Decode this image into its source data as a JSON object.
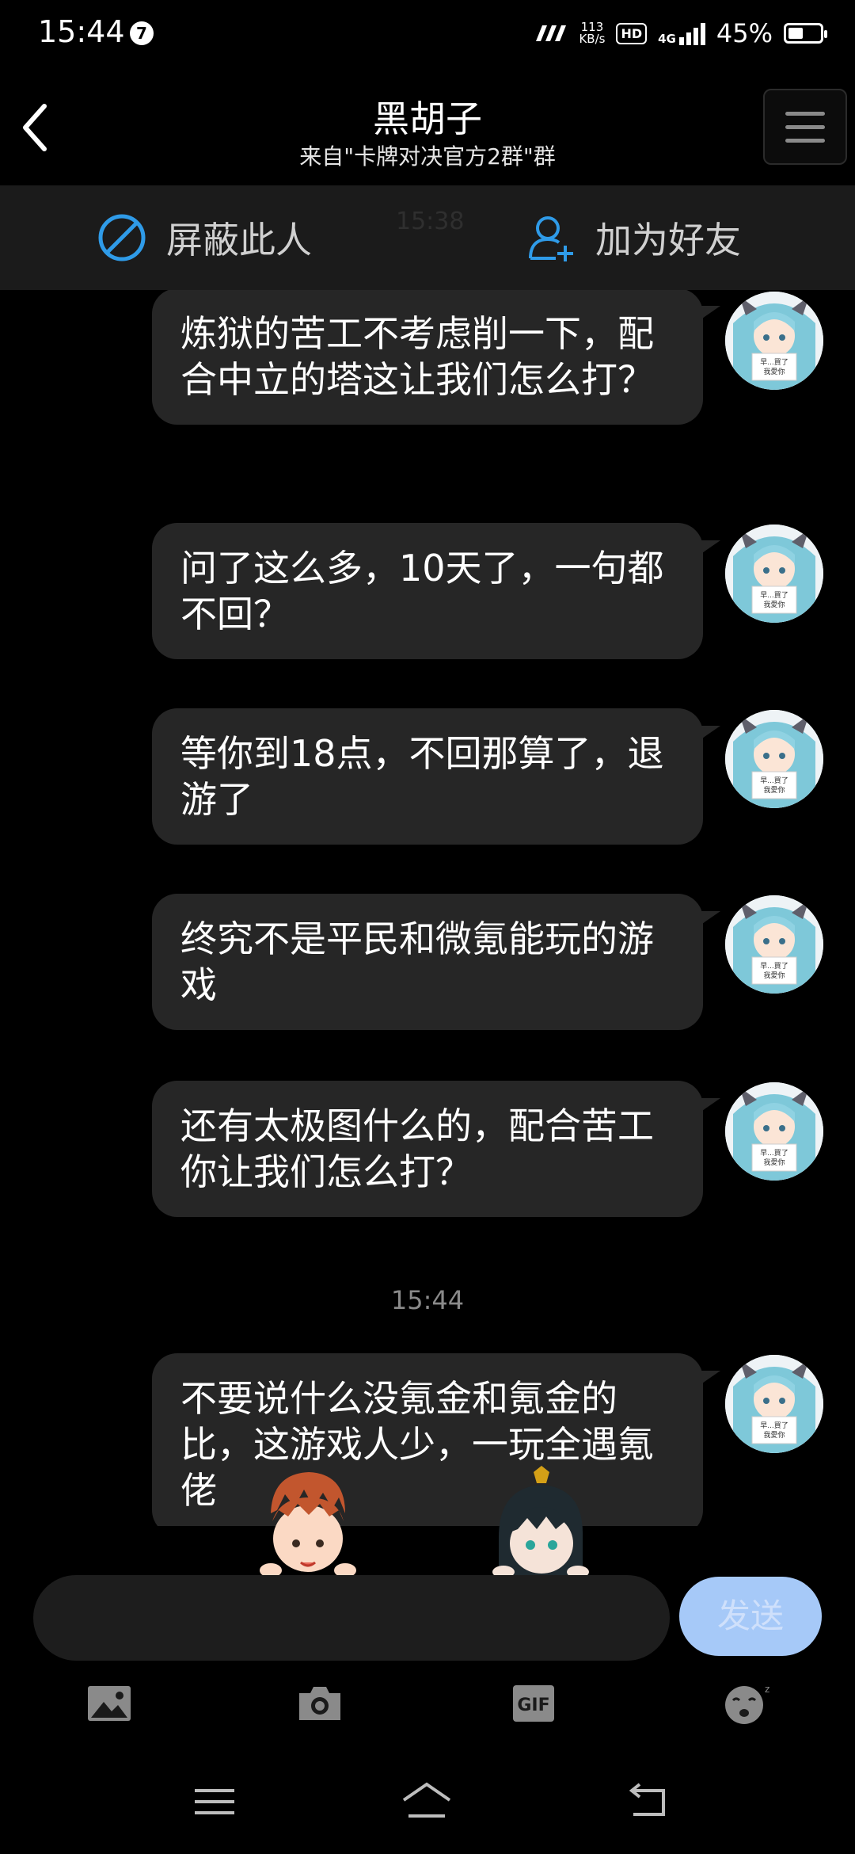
{
  "status_bar": {
    "time": "15:44",
    "notification_count": "7",
    "net_speed_value": "113",
    "net_speed_unit": "KB/s",
    "hd_label": "HD",
    "network_type": "4G",
    "battery_percent": "45%"
  },
  "header": {
    "title": "黑胡子",
    "subtitle": "来自\"卡牌对决官方2群\"群"
  },
  "actions": {
    "block_label": "屏蔽此人",
    "add_friend_label": "加为好友",
    "faded_time": "15:38"
  },
  "messages": [
    {
      "text": "炼狱的苦工不考虑削一下，配合中立的塔这让我们怎么打？"
    },
    {
      "text": "问了这么多，10天了，一句都不回？"
    },
    {
      "text": "等你到18点，不回那算了，退游了"
    },
    {
      "text": "终究不是平民和微氪能玩的游戏"
    },
    {
      "text": "还有太极图什么的，配合苦工你让我们怎么打？"
    },
    {
      "text": "不要说什么没氪金和氪金的比，这游戏人少，一玩全遇氪佬"
    }
  ],
  "timestamp": "15:44",
  "avatar_sign_text": "早...買了\n我愛你",
  "input": {
    "value": "",
    "placeholder": "",
    "send_label": "发送"
  },
  "toolbar": {
    "gif_label": "GIF"
  },
  "colors": {
    "bubble": "#262626",
    "send_button": "#a6c9f8",
    "accent_blue": "#2f9be8"
  }
}
